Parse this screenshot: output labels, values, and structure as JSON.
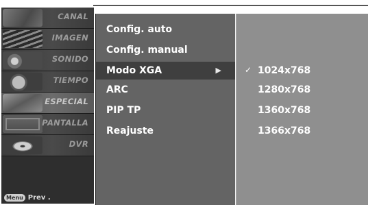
{
  "categories": [
    {
      "label": "CANAL"
    },
    {
      "label": "IMAGEN"
    },
    {
      "label": "SONIDO"
    },
    {
      "label": "TIEMPO"
    },
    {
      "label": "ESPECIAL"
    },
    {
      "label": "PANTALLA"
    },
    {
      "label": "DVR"
    }
  ],
  "footer": {
    "menu_key": "Menu",
    "prev_label": "Prev ."
  },
  "submenu": {
    "items": [
      {
        "label": "Config. auto"
      },
      {
        "label": "Config. manual"
      },
      {
        "label": "Modo XGA",
        "arrow": "▶"
      },
      {
        "label": "ARC"
      },
      {
        "label": "PIP TP"
      },
      {
        "label": "Reajuste"
      }
    ]
  },
  "xga_options": {
    "check_mark": "✓",
    "items": [
      {
        "label": "1024x768"
      },
      {
        "label": "1280x768"
      },
      {
        "label": "1360x768"
      },
      {
        "label": "1366x768"
      }
    ]
  },
  "colors": {
    "sidebar": "#2e2e2e",
    "submenu": "#646464",
    "submenu_selected": "#3f3f3f",
    "options": "#8f8f8f",
    "text": "#ffffff"
  }
}
